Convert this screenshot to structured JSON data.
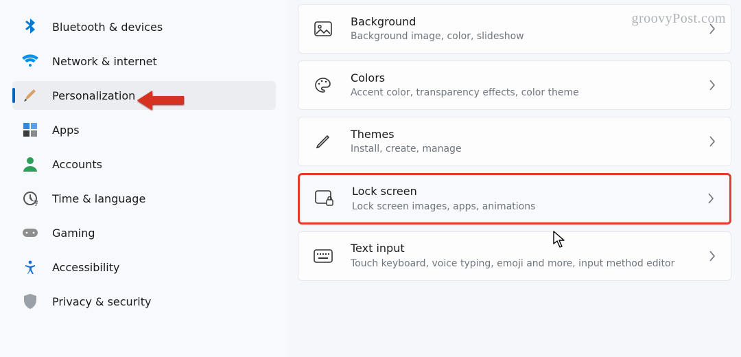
{
  "watermark": "groovyPost.com",
  "sidebar": {
    "selected_index": 2,
    "items": [
      {
        "label": "Bluetooth & devices",
        "icon": "bluetooth-icon"
      },
      {
        "label": "Network & internet",
        "icon": "wifi-icon"
      },
      {
        "label": "Personalization",
        "icon": "paintbrush-icon"
      },
      {
        "label": "Apps",
        "icon": "apps-icon"
      },
      {
        "label": "Accounts",
        "icon": "person-icon"
      },
      {
        "label": "Time & language",
        "icon": "clock-language-icon"
      },
      {
        "label": "Gaming",
        "icon": "gamepad-icon"
      },
      {
        "label": "Accessibility",
        "icon": "accessibility-icon"
      },
      {
        "label": "Privacy & security",
        "icon": "shield-icon"
      }
    ]
  },
  "cards": [
    {
      "title": "Background",
      "subtitle": "Background image, color, slideshow",
      "icon": "image-icon",
      "highlighted": false
    },
    {
      "title": "Colors",
      "subtitle": "Accent color, transparency effects, color theme",
      "icon": "palette-icon",
      "highlighted": false
    },
    {
      "title": "Themes",
      "subtitle": "Install, create, manage",
      "icon": "pen-icon",
      "highlighted": false
    },
    {
      "title": "Lock screen",
      "subtitle": "Lock screen images, apps, animations",
      "icon": "lock-screen-icon",
      "highlighted": true
    },
    {
      "title": "Text input",
      "subtitle": "Touch keyboard, voice typing, emoji and more, input method editor",
      "icon": "keyboard-icon",
      "highlighted": false
    }
  ],
  "annotations": {
    "arrow_points_to": "Personalization",
    "cursor_over": "Lock screen"
  }
}
